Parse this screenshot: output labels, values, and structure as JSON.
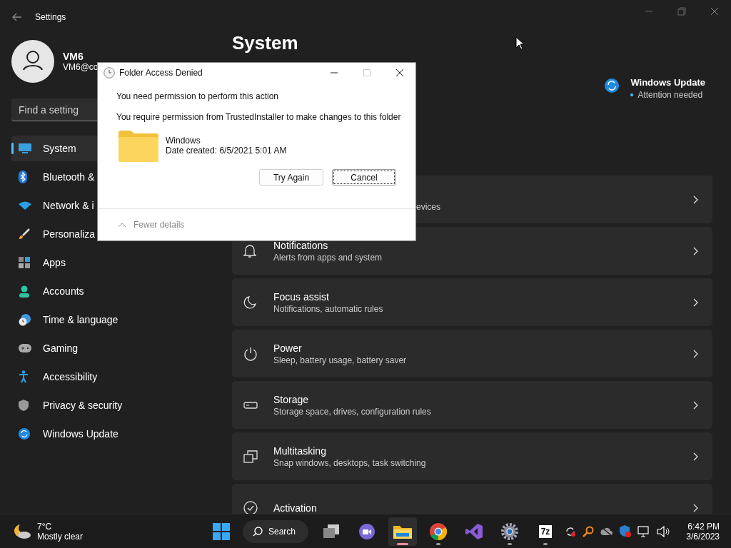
{
  "window": {
    "title": "Settings"
  },
  "account": {
    "name": "VM6",
    "email": "VM6@co"
  },
  "search": {
    "placeholder": "Find a setting"
  },
  "sidebar": {
    "items": [
      {
        "label": "System",
        "selected": true
      },
      {
        "label": "Bluetooth &",
        "selected": false
      },
      {
        "label": "Network & i",
        "selected": false
      },
      {
        "label": "Personaliza",
        "selected": false
      },
      {
        "label": "Apps",
        "selected": false
      },
      {
        "label": "Accounts",
        "selected": false
      },
      {
        "label": "Time & language",
        "selected": false
      },
      {
        "label": "Gaming",
        "selected": false
      },
      {
        "label": "Accessibility",
        "selected": false
      },
      {
        "label": "Privacy & security",
        "selected": false
      },
      {
        "label": "Windows Update",
        "selected": false
      }
    ]
  },
  "page": {
    "title": "System"
  },
  "update_status": {
    "title": "Windows Update",
    "status": "Attention needed"
  },
  "cards": [
    {
      "subtitle": "evices"
    },
    {
      "title": "Notifications",
      "subtitle": "Alerts from apps and system"
    },
    {
      "title": "Focus assist",
      "subtitle": "Notifications, automatic rules"
    },
    {
      "title": "Power",
      "subtitle": "Sleep, battery usage, battery saver"
    },
    {
      "title": "Storage",
      "subtitle": "Storage space, drives, configuration rules"
    },
    {
      "title": "Multitasking",
      "subtitle": "Snap windows, desktops, task switching"
    },
    {
      "title": "Activation"
    }
  ],
  "dialog": {
    "title": "Folder Access Denied",
    "message": "You need permission to perform this action",
    "detail": "You require permission from TrustedInstaller to make changes to this folder",
    "item_name": "Windows",
    "item_date": "Date created: 6/5/2021 5:01 AM",
    "buttons": [
      {
        "label": "Try Again",
        "focused": false
      },
      {
        "label": "Cancel",
        "focused": true
      }
    ],
    "details_toggle": "Fewer details"
  },
  "taskbar": {
    "weather": {
      "temp": "7°C",
      "condition": "Mostly clear"
    },
    "search_label": "Search",
    "apps": [
      {
        "kind": "taskview",
        "active": false,
        "running": false
      },
      {
        "kind": "chat",
        "active": false,
        "running": false
      },
      {
        "kind": "explorer",
        "active": true,
        "running": true
      },
      {
        "kind": "chrome",
        "active": false,
        "running": true
      },
      {
        "kind": "vs",
        "active": false,
        "running": false
      },
      {
        "kind": "settings",
        "active": false,
        "running": true
      },
      {
        "kind": "sevenzip",
        "label": "7z",
        "active": false,
        "running": true
      }
    ],
    "time": "6:42 PM",
    "date": "3/6/2023"
  }
}
